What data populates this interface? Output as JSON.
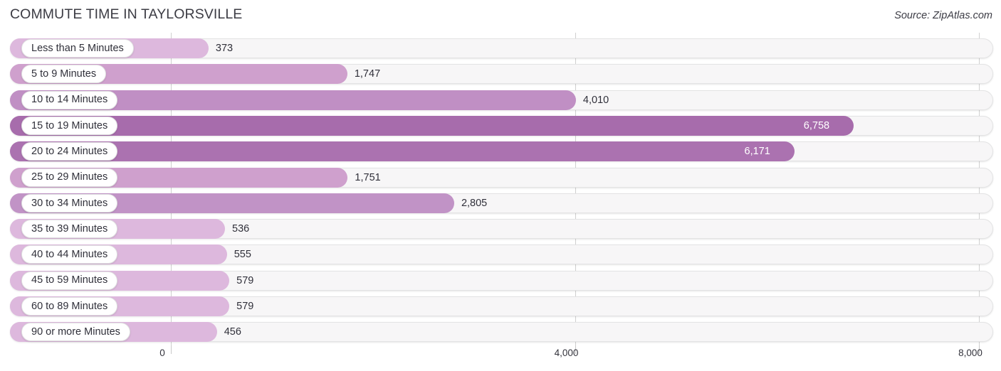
{
  "header": {
    "title": "COMMUTE TIME IN TAYLORSVILLE",
    "source": "Source: ZipAtlas.com"
  },
  "axis": {
    "ticks": [
      {
        "label": "0",
        "value": 0
      },
      {
        "label": "4,000",
        "value": 4000
      },
      {
        "label": "8,000",
        "value": 8000
      }
    ]
  },
  "colors": {
    "bar_light": "#ddb8dd",
    "bar_mid": "#cfa0cd",
    "bar_dark": "#b482bb",
    "bar_darkest": "#a76cac",
    "track": "#f7f6f7",
    "gridline": "#d0d0d0",
    "text": "#30303a"
  },
  "chart_data": {
    "type": "bar",
    "orientation": "horizontal",
    "title": "COMMUTE TIME IN TAYLORSVILLE",
    "subtitle": "",
    "xlabel": "",
    "ylabel": "",
    "xlim": [
      0,
      8000
    ],
    "grid": true,
    "legend": false,
    "source": "Source: ZipAtlas.com",
    "categories": [
      "Less than 5 Minutes",
      "5 to 9 Minutes",
      "10 to 14 Minutes",
      "15 to 19 Minutes",
      "20 to 24 Minutes",
      "25 to 29 Minutes",
      "30 to 34 Minutes",
      "35 to 39 Minutes",
      "40 to 44 Minutes",
      "45 to 59 Minutes",
      "60 to 89 Minutes",
      "90 or more Minutes"
    ],
    "values": [
      373,
      1747,
      4010,
      6758,
      6171,
      1751,
      2805,
      536,
      555,
      579,
      579,
      456
    ],
    "value_labels": [
      "373",
      "1,747",
      "4,010",
      "6,758",
      "6,171",
      "1,751",
      "2,805",
      "536",
      "555",
      "579",
      "579",
      "456"
    ],
    "tick_labels": [
      "0",
      "4,000",
      "8,000"
    ],
    "bar_colors": [
      "#ddb8dd",
      "#cfa0cd",
      "#c08fc4",
      "#a76cac",
      "#ab72b0",
      "#cfa0cd",
      "#c193c6",
      "#ddb8dd",
      "#ddb8dd",
      "#ddb8dd",
      "#ddb8dd",
      "#ddb8dd"
    ],
    "label_inside": [
      false,
      false,
      false,
      true,
      true,
      false,
      false,
      false,
      false,
      false,
      false,
      false
    ]
  }
}
